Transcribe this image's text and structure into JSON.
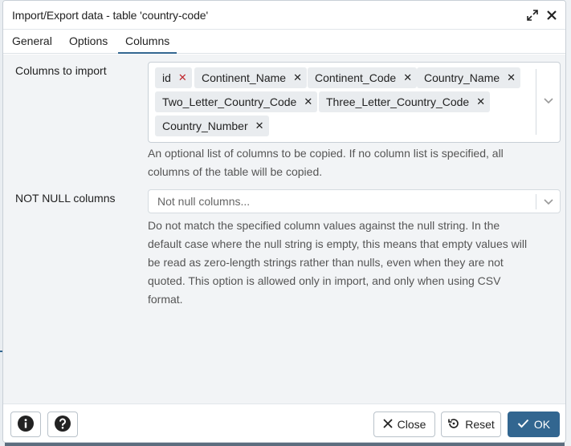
{
  "dialog": {
    "title": "Import/Export data - table 'country-code'"
  },
  "tabs": [
    {
      "label": "General"
    },
    {
      "label": "Options"
    },
    {
      "label": "Columns",
      "active": true
    }
  ],
  "columns_to_import": {
    "label": "Columns to import",
    "chips": [
      "id",
      "Continent_Name",
      "Continent_Code",
      "Country_Name",
      "Two_Letter_Country_Code",
      "Three_Letter_Country_Code",
      "Country_Number"
    ],
    "help_line1": "An optional list of columns to be copied. If no column list is specified, all",
    "help_line2": "columns of the table will be copied."
  },
  "not_null_columns": {
    "label": "NOT NULL columns",
    "placeholder": "Not null columns...",
    "help_lines": [
      "Do not match the specified column values against the null string. In the",
      "default case where the null string is empty, this means that empty values will",
      "be read as zero-length strings rather than nulls, even when they are not",
      "quoted. This option is allowed only in import, and only when using CSV",
      "format."
    ]
  },
  "footer": {
    "info_icon": "info-icon",
    "help_icon": "question-icon",
    "close_label": "Close",
    "reset_label": "Reset",
    "ok_label": "OK"
  },
  "colors": {
    "accent": "#326690",
    "chip_bg": "#e9ecef",
    "remove_red": "#c0262c"
  }
}
